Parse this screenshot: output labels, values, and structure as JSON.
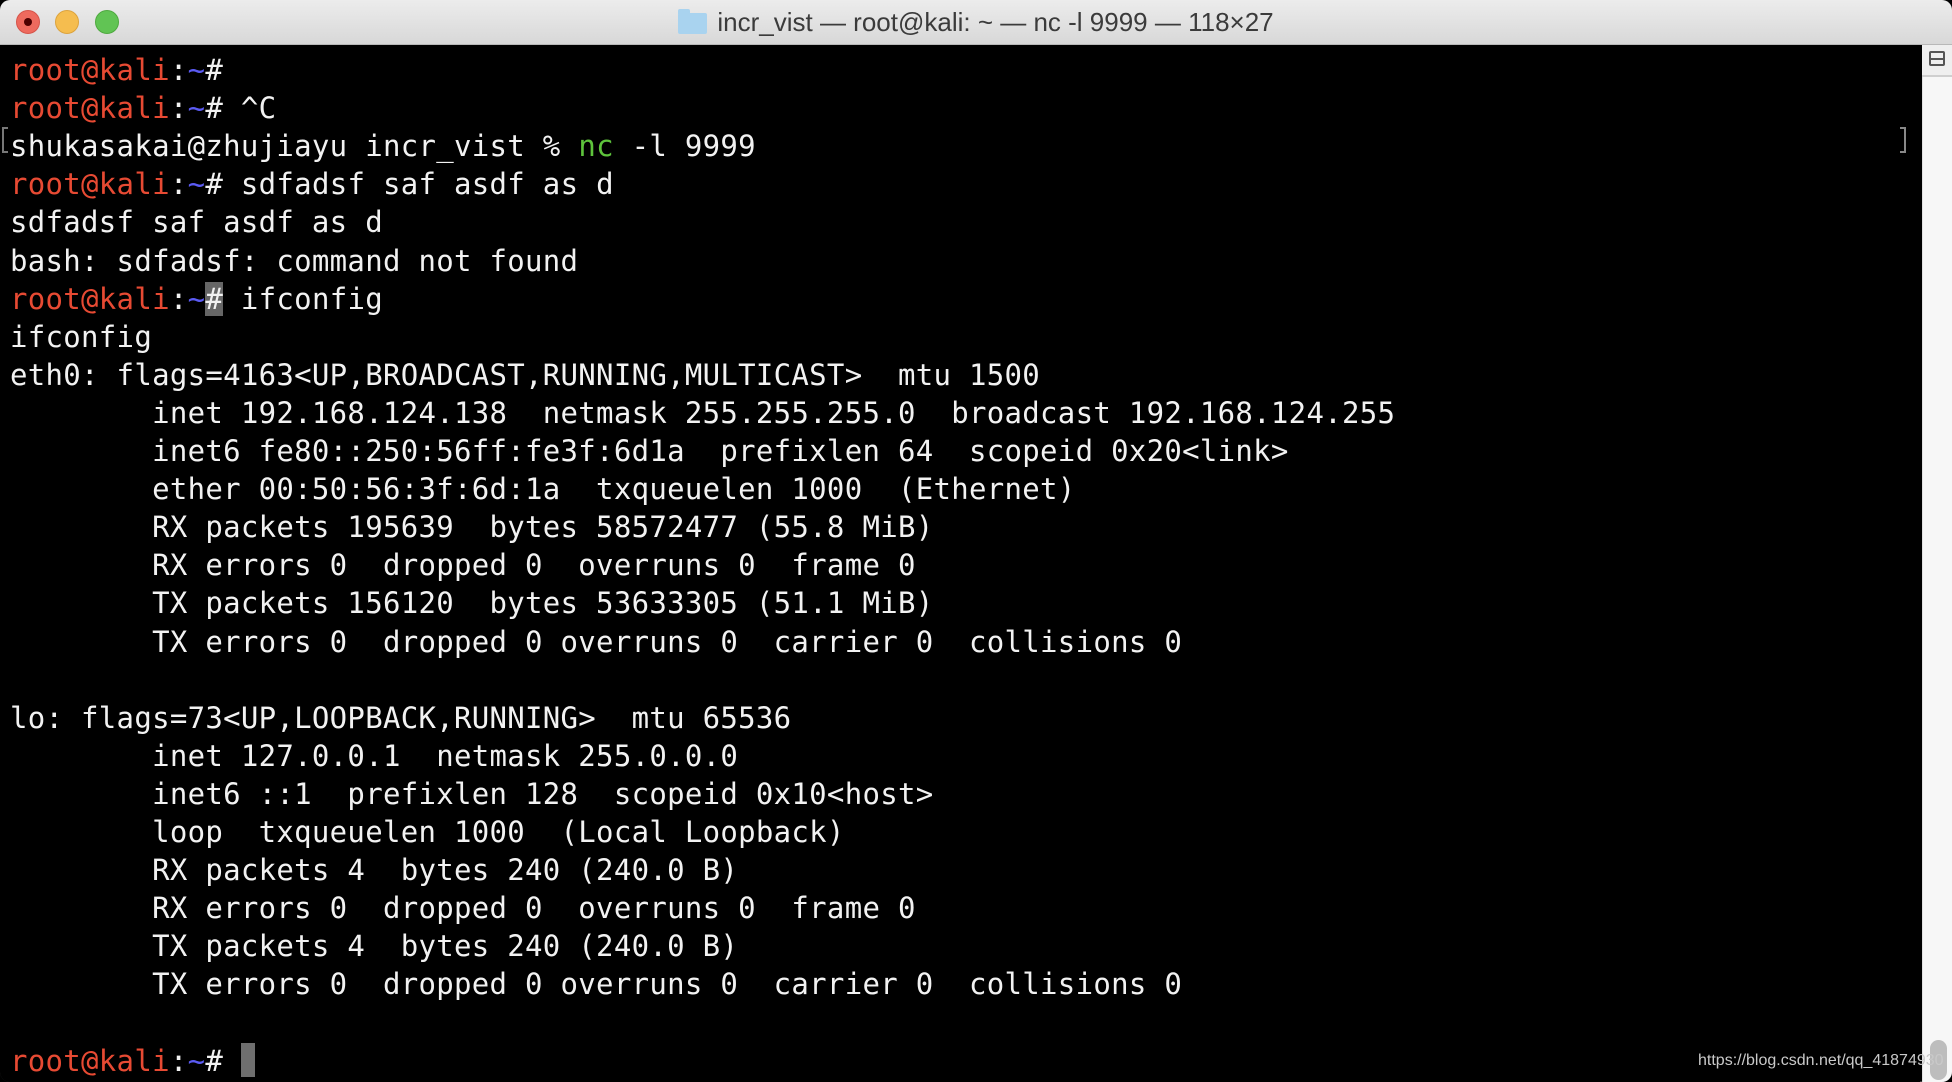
{
  "window": {
    "title": "incr_vist — root@kali: ~ — nc -l 9999 — 118×27",
    "folder_icon": "folder-icon",
    "buttons": [
      "close",
      "minimize",
      "maximize"
    ]
  },
  "prompt": {
    "user_host": "root@kali",
    "colon": ":",
    "path": "~",
    "symbol": "#"
  },
  "terminal": {
    "lines": [
      {
        "type": "prompt",
        "cmd": ""
      },
      {
        "type": "prompt",
        "cmd": " ^C"
      },
      {
        "type": "local",
        "before": "shukasakai@zhujiayu incr_vist % ",
        "highlight": "nc",
        "after": " -l 9999"
      },
      {
        "type": "prompt",
        "cmd": " sdfadsf saf asdf as d"
      },
      {
        "type": "text",
        "text": "sdfadsf saf asdf as d"
      },
      {
        "type": "text",
        "text": "bash: sdfadsf: command not found"
      },
      {
        "type": "prompt-sel",
        "cmd": " ifconfig"
      },
      {
        "type": "text",
        "text": "ifconfig"
      },
      {
        "type": "text",
        "text": "eth0: flags=4163<UP,BROADCAST,RUNNING,MULTICAST>  mtu 1500"
      },
      {
        "type": "text",
        "text": "        inet 192.168.124.138  netmask 255.255.255.0  broadcast 192.168.124.255"
      },
      {
        "type": "text",
        "text": "        inet6 fe80::250:56ff:fe3f:6d1a  prefixlen 64  scopeid 0x20<link>"
      },
      {
        "type": "text",
        "text": "        ether 00:50:56:3f:6d:1a  txqueuelen 1000  (Ethernet)"
      },
      {
        "type": "text",
        "text": "        RX packets 195639  bytes 58572477 (55.8 MiB)"
      },
      {
        "type": "text",
        "text": "        RX errors 0  dropped 0  overruns 0  frame 0"
      },
      {
        "type": "text",
        "text": "        TX packets 156120  bytes 53633305 (51.1 MiB)"
      },
      {
        "type": "text",
        "text": "        TX errors 0  dropped 0 overruns 0  carrier 0  collisions 0"
      },
      {
        "type": "text",
        "text": ""
      },
      {
        "type": "text",
        "text": "lo: flags=73<UP,LOOPBACK,RUNNING>  mtu 65536"
      },
      {
        "type": "text",
        "text": "        inet 127.0.0.1  netmask 255.0.0.0"
      },
      {
        "type": "text",
        "text": "        inet6 ::1  prefixlen 128  scopeid 0x10<host>"
      },
      {
        "type": "text",
        "text": "        loop  txqueuelen 1000  (Local Loopback)"
      },
      {
        "type": "text",
        "text": "        RX packets 4  bytes 240 (240.0 B)"
      },
      {
        "type": "text",
        "text": "        RX errors 0  dropped 0  overruns 0  frame 0"
      },
      {
        "type": "text",
        "text": "        TX packets 4  bytes 240 (240.0 B)"
      },
      {
        "type": "text",
        "text": "        TX errors 0  dropped 0 overruns 0  carrier 0  collisions 0"
      },
      {
        "type": "text",
        "text": ""
      },
      {
        "type": "prompt-cursor",
        "cmd": " "
      }
    ]
  },
  "watermark": "https://blog.csdn.net/qq_41874930",
  "colors": {
    "prompt_user": "#e74a33",
    "prompt_path": "#5b5bf3",
    "command_highlight": "#5ec33c",
    "background": "#000000",
    "foreground": "#f2f2f2"
  }
}
